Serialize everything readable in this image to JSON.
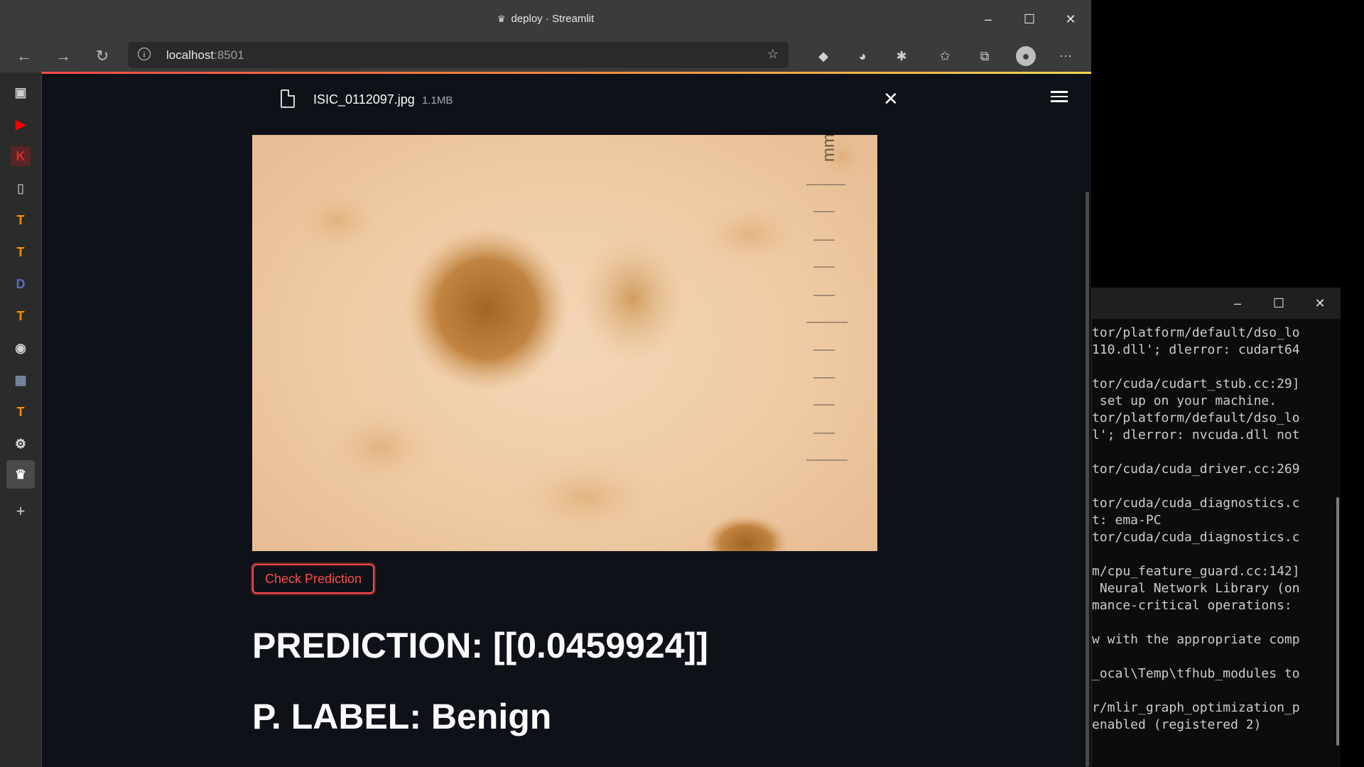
{
  "window": {
    "title": "deploy · Streamlit"
  },
  "address_bar": {
    "host": "localhost",
    "port": ":8501"
  },
  "uploaded_file": {
    "name": "ISIC_0112097.jpg",
    "size": "1.1MB"
  },
  "image_scale_label": "mm",
  "button": {
    "label": "Check Prediction"
  },
  "prediction": {
    "text": "PREDICTION: [[0.0459924]]"
  },
  "label": {
    "text": "P. LABEL: Benign"
  },
  "sidebar_icons": [
    "tab-panel-icon",
    "youtube-icon",
    "kaggle-icon",
    "document-icon",
    "tensorflow-icon",
    "tensorflow-icon",
    "dreamfusion-icon",
    "tensorflow-icon",
    "github-icon",
    "image-icon",
    "tensorflow-icon",
    "apps-icon",
    "streamlit-icon",
    "add-icon"
  ],
  "terminal": {
    "lines": [
      "tor/platform/default/dso_lo",
      "110.dll'; dlerror: cudart64",
      "",
      "tor/cuda/cudart_stub.cc:29]",
      " set up on your machine.",
      "tor/platform/default/dso_lo",
      "l'; dlerror: nvcuda.dll not",
      "",
      "tor/cuda/cuda_driver.cc:269",
      "",
      "tor/cuda/cuda_diagnostics.c",
      "t: ema-PC",
      "tor/cuda/cuda_diagnostics.c",
      "",
      "m/cpu_feature_guard.cc:142]",
      " Neural Network Library (on",
      "mance-critical operations:",
      "",
      "w with the appropriate comp",
      "",
      "_ocal\\Temp\\tfhub_modules to",
      "",
      "r/mlir_graph_optimization_p",
      "enabled (registered 2)"
    ]
  },
  "colors": {
    "accent": "#ff4b4b",
    "app_bg": "#0e1117",
    "chrome_bg": "#3b3b3b"
  }
}
